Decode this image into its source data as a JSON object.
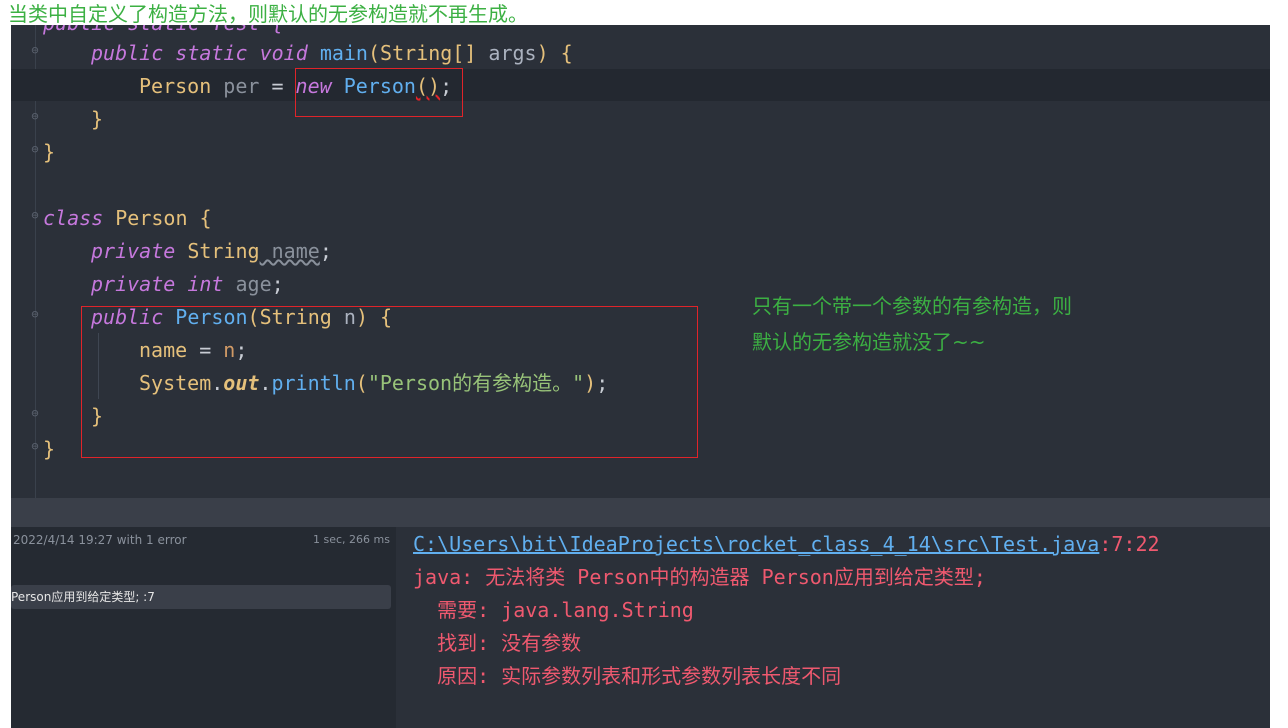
{
  "annotation_top": "当类中自定义了构造方法，则默认的无参构造就不再生成。",
  "annotation_side": {
    "line1": "只有一个带一个参数的有参构造，则",
    "line2": "默认的无参构造就没了~~"
  },
  "code": {
    "line_partial": "public static Test {",
    "main_sig": {
      "kw1": "public",
      "kw2": "static",
      "kw3": "void",
      "name": "main",
      "open": "(",
      "type": "String[]",
      "arg": " args",
      "close": ")",
      "brace": " {"
    },
    "main_body": {
      "type": "Person",
      "var": " per",
      "eq": " = ",
      "kw": "new",
      "cls": " Person",
      "call": "()",
      "semi": ";"
    },
    "close1": "}",
    "close2": "}",
    "class_decl": {
      "kw": "class",
      "name": " Person",
      "brace": " {"
    },
    "field1": {
      "kw": "private",
      "type": " String",
      "name": " name",
      "semi": ";"
    },
    "field2": {
      "kw": "private",
      "type": " int",
      "name": " age",
      "semi": ";"
    },
    "ctor": {
      "kw": "public",
      "name": " Person",
      "open": "(",
      "type": "String",
      "arg": " n",
      "close": ")",
      "brace": " {"
    },
    "assign": {
      "lhs": "name",
      "eq": " = ",
      "rhs": "n",
      "semi": ";"
    },
    "print": {
      "cls": "System",
      "dot1": ".",
      "out": "out",
      "dot2": ".",
      "fn": "println",
      "open": "(",
      "str": "\"Person的有参构造。\"",
      "close": ")",
      "semi": ";"
    },
    "close3": "}",
    "close4": "}"
  },
  "build": {
    "time": "2022/4/14 19:27 with 1 error",
    "duration": "1 sec, 266 ms",
    "error_item": "Person应用到给定类型; :7"
  },
  "output": {
    "path": "C:\\Users\\bit\\IdeaProjects\\rocket_class_4_14\\src\\Test.java",
    "loc": ":7:22",
    "line1": "java: 无法将类 Person中的构造器 Person应用到给定类型;",
    "line2": "  需要: java.lang.String",
    "line3": "  找到: 没有参数",
    "line4": "  原因: 实际参数列表和形式参数列表长度不同"
  }
}
